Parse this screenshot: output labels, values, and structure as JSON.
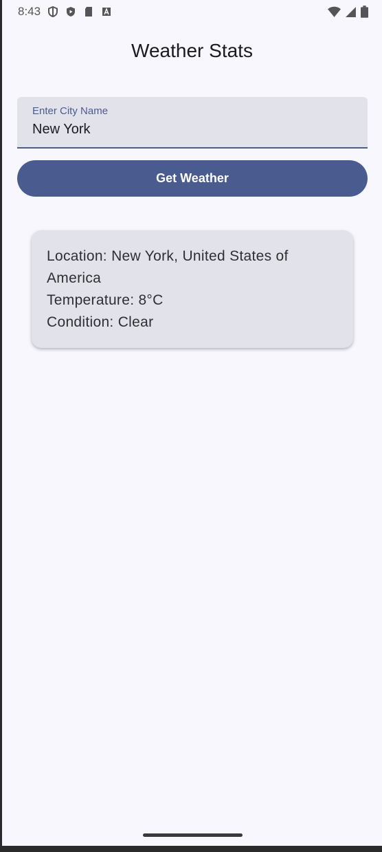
{
  "status_bar": {
    "time": "8:43",
    "left_icons": [
      "shield-outline-icon",
      "shield-play-icon",
      "sd-card-icon",
      "font-a-icon"
    ],
    "right_icons": [
      "wifi-icon",
      "signal-icon",
      "battery-icon"
    ]
  },
  "header": {
    "title": "Weather Stats"
  },
  "search": {
    "label": "Enter City Name",
    "value": "New York"
  },
  "actions": {
    "get_weather_label": "Get Weather"
  },
  "result": {
    "location": "Location: New York, United States of America",
    "temperature": "Temperature: 8°C",
    "condition": "Condition: Clear"
  },
  "colors": {
    "accent": "#4a5b8f",
    "background": "#f8f7fd",
    "surface": "#e2e2ea"
  }
}
